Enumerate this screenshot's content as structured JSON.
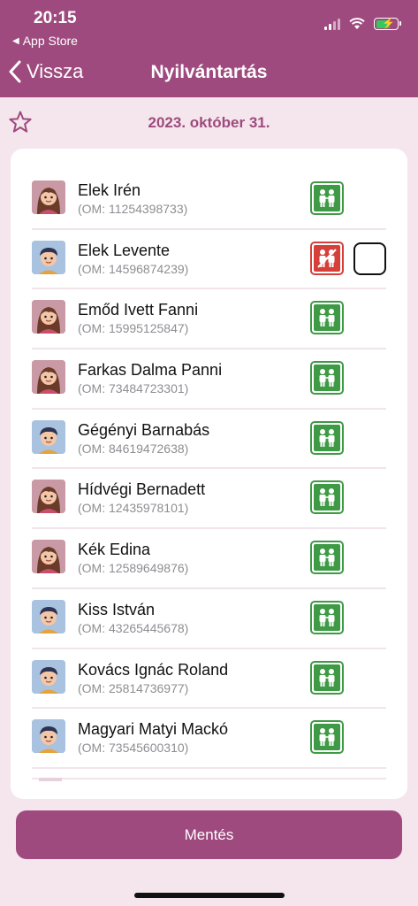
{
  "status_bar": {
    "time": "20:15",
    "back_app": "App Store",
    "icons": [
      "signal-icon",
      "wifi-icon",
      "battery-charging-icon"
    ]
  },
  "nav": {
    "back_label": "Vissza",
    "title": "Nyilvántartás"
  },
  "date": "2023. október 31.",
  "students": [
    {
      "name": "Elek Irén",
      "om": "(OM: 11254398733)",
      "avatar": "girl",
      "status": "present"
    },
    {
      "name": "Elek Levente",
      "om": "(OM: 14596874239)",
      "avatar": "boy",
      "status": "absent"
    },
    {
      "name": "Emőd Ivett Fanni",
      "om": "(OM: 15995125847)",
      "avatar": "girl",
      "status": "present"
    },
    {
      "name": "Farkas Dalma Panni",
      "om": "(OM: 73484723301)",
      "avatar": "girl",
      "status": "present"
    },
    {
      "name": "Gégényi Barnabás",
      "om": "(OM: 84619472638)",
      "avatar": "boy",
      "status": "present"
    },
    {
      "name": "Hídvégi Bernadett",
      "om": "(OM: 12435978101)",
      "avatar": "girl",
      "status": "present"
    },
    {
      "name": "Kék Edina",
      "om": "(OM: 12589649876)",
      "avatar": "girl",
      "status": "present"
    },
    {
      "name": "Kiss István",
      "om": "(OM: 43265445678)",
      "avatar": "boy",
      "status": "present"
    },
    {
      "name": "Kovács Ignác Roland",
      "om": "(OM: 25814736977)",
      "avatar": "boy",
      "status": "present"
    },
    {
      "name": "Magyari Matyi Mackó",
      "om": "(OM: 73545600310)",
      "avatar": "boy",
      "status": "present"
    }
  ],
  "save_label": "Mentés",
  "colors": {
    "brand": "#9e4a7e",
    "background": "#f4e6ec",
    "present": "#3e9a45",
    "absent": "#d6403b"
  }
}
